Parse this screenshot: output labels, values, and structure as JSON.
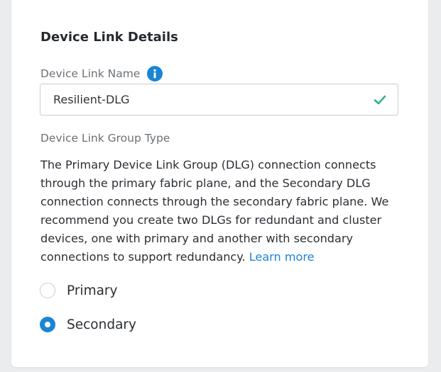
{
  "card": {
    "title": "Device Link Details"
  },
  "device_link_name": {
    "label": "Device Link Name",
    "info_icon": "info-icon",
    "value": "Resilient-DLG",
    "valid_icon": "check-icon",
    "valid_color": "#2fb67f"
  },
  "group_type": {
    "label": "Device Link Group Type",
    "description_lines": [
      "The Primary Device Link Group (DLG) connection connects",
      "through the primary fabric plane, and the Secondary DLG",
      "connection connects through the secondary fabric plane. We",
      "recommend you create two DLGs for redundant and cluster",
      "devices, one with primary and another with secondary",
      "connections to support redundancy."
    ],
    "learn_more": "Learn more",
    "options": [
      {
        "label": "Primary",
        "selected": false
      },
      {
        "label": "Secondary",
        "selected": true
      }
    ]
  },
  "colors": {
    "accent": "#1a84d6",
    "valid": "#2fb67f"
  }
}
